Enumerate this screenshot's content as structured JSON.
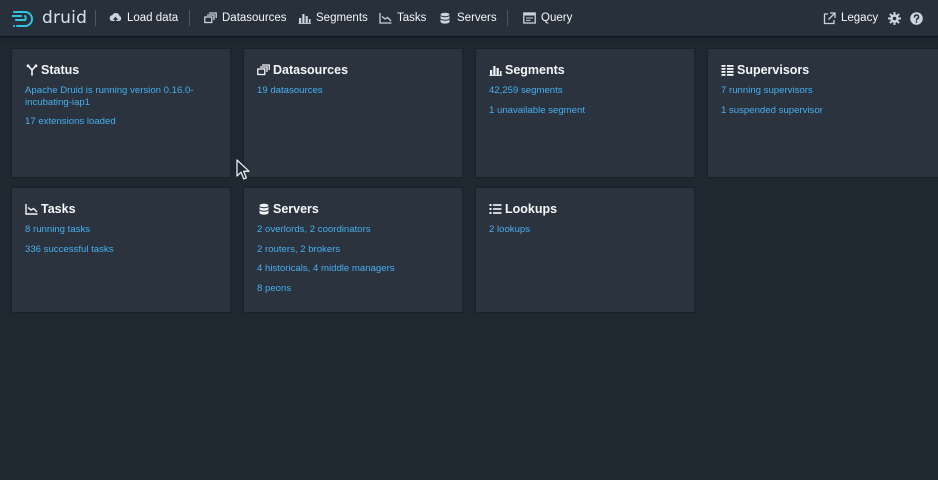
{
  "navbar": {
    "logo_text": "druid",
    "items": [
      {
        "label": "Load data",
        "icon": "cloud-upload-icon"
      },
      {
        "label": "Datasources",
        "icon": "multi-select-icon"
      },
      {
        "label": "Segments",
        "icon": "stacked-chart-icon"
      },
      {
        "label": "Tasks",
        "icon": "gantt-chart-icon"
      },
      {
        "label": "Servers",
        "icon": "database-icon"
      },
      {
        "label": "Query",
        "icon": "application-icon"
      }
    ],
    "legacy_label": "Legacy",
    "legacy_icon": "share-icon",
    "settings_icon": "cog-icon",
    "help_icon": "help-icon"
  },
  "cards": {
    "status": {
      "title": "Status",
      "icon": "git-branch-icon",
      "lines": [
        "Apache Druid is running version 0.16.0-incubating-iap1",
        "17 extensions loaded"
      ]
    },
    "datasources": {
      "title": "Datasources",
      "icon": "multi-select-icon",
      "lines": [
        "19 datasources"
      ]
    },
    "segments": {
      "title": "Segments",
      "icon": "stacked-chart-icon",
      "lines": [
        "42,259 segments",
        "1 unavailable segment"
      ]
    },
    "supervisors": {
      "title": "Supervisors",
      "icon": "list-columns-icon",
      "lines": [
        "7 running supervisors",
        "1 suspended supervisor"
      ]
    },
    "tasks": {
      "title": "Tasks",
      "icon": "gantt-chart-icon",
      "lines": [
        "8 running tasks",
        "336 successful tasks"
      ]
    },
    "servers": {
      "title": "Servers",
      "icon": "database-icon",
      "lines": [
        "2 overlords, 2 coordinators",
        "2 routers, 2 brokers",
        "4 historicals, 4 middle managers",
        "8 peons"
      ]
    },
    "lookups": {
      "title": "Lookups",
      "icon": "properties-icon",
      "lines": [
        "2 lookups"
      ]
    }
  },
  "colors": {
    "background": "#1f2731",
    "navbar": "#27303b",
    "card": "#2a333e",
    "link": "#48aff0",
    "logo": "#2ec5e0"
  }
}
